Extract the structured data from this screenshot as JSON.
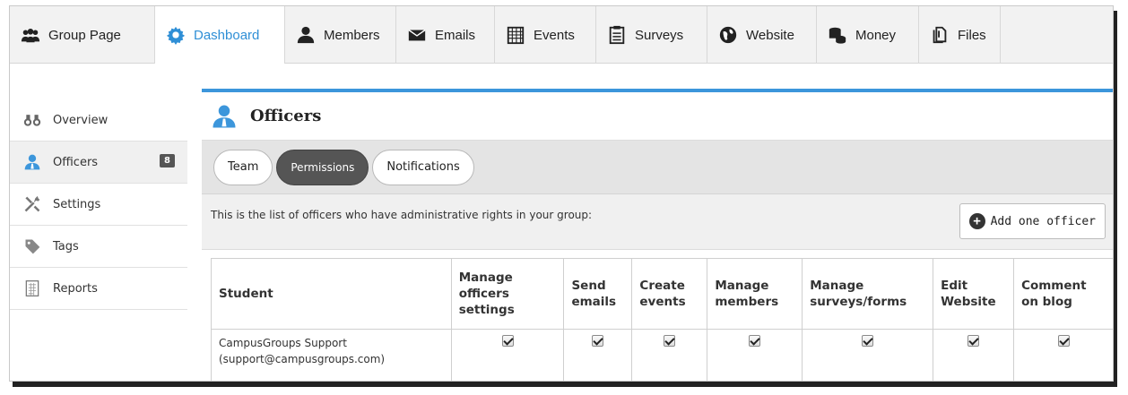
{
  "topnav": [
    {
      "label": "Group Page",
      "icon": "group-icon",
      "active": false
    },
    {
      "label": "Dashboard",
      "icon": "gear-icon",
      "active": true
    },
    {
      "label": "Members",
      "icon": "member-icon",
      "active": false
    },
    {
      "label": "Emails",
      "icon": "envelope-icon",
      "active": false
    },
    {
      "label": "Events",
      "icon": "calendar-icon",
      "active": false
    },
    {
      "label": "Surveys",
      "icon": "clipboard-icon",
      "active": false
    },
    {
      "label": "Website",
      "icon": "globe-icon",
      "active": false
    },
    {
      "label": "Money",
      "icon": "coins-icon",
      "active": false
    },
    {
      "label": "Files",
      "icon": "files-icon",
      "active": false
    }
  ],
  "sidebar": {
    "items": [
      {
        "label": "Overview",
        "icon": "binoculars-icon"
      },
      {
        "label": "Officers",
        "icon": "officer-icon",
        "badge": "8"
      },
      {
        "label": "Settings",
        "icon": "tools-icon"
      },
      {
        "label": "Tags",
        "icon": "tag-icon"
      },
      {
        "label": "Reports",
        "icon": "report-icon"
      }
    ]
  },
  "main": {
    "title": "Officers",
    "tabs": [
      {
        "label": "Team"
      },
      {
        "label": "Permissions"
      },
      {
        "label": "Notifications"
      }
    ],
    "info_text": "This is the list of officers who have administrative rights in your group:",
    "add_button": "Add one officer",
    "table": {
      "headers": [
        "Student",
        "Manage officers settings",
        "Send emails",
        "Create events",
        "Manage members",
        "Manage surveys/forms",
        "Edit Website",
        "Comment on blog"
      ],
      "rows": [
        {
          "student_name": "CampusGroups Support",
          "student_email": "(support@campusgroups.com)",
          "permissions": [
            true,
            true,
            true,
            true,
            true,
            true,
            true
          ]
        }
      ]
    }
  },
  "colors": {
    "accent": "#2f8fd6",
    "topbar": "#3c96db",
    "active_tab": "#555555"
  }
}
